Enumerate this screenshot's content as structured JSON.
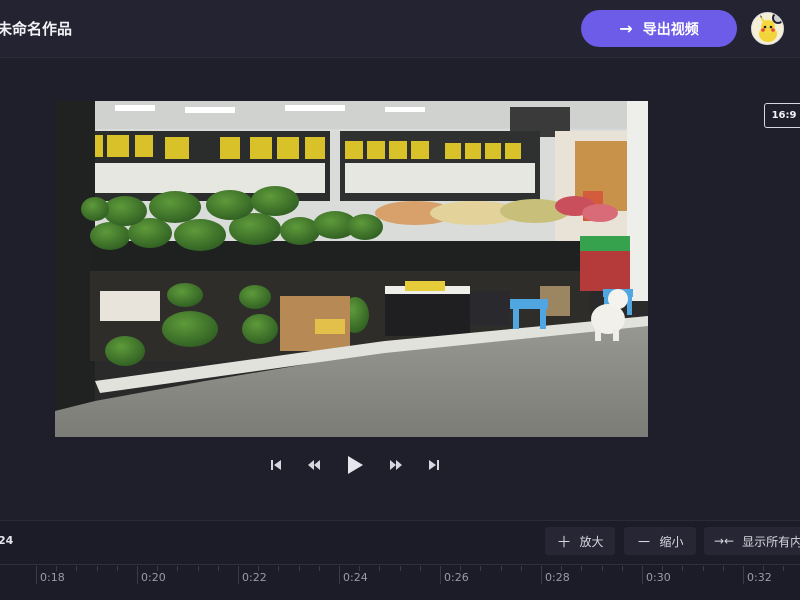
{
  "header": {
    "project_title": "未命名作品",
    "export_label": "导出视频"
  },
  "preview": {
    "aspect_ratio": "16:9"
  },
  "timeline": {
    "current_time": "24",
    "zoom_in_label": "放大",
    "zoom_out_label": "缩小",
    "show_all_label": "显示所有内",
    "ticks": [
      "0:18",
      "0:20",
      "0:22",
      "0:24",
      "0:26",
      "0:28",
      "0:30",
      "0:32"
    ]
  },
  "colors": {
    "accent": "#6c5ce7",
    "background": "#1f1f2c"
  },
  "icons": {
    "export": "arrow-right-icon",
    "zoom_in": "plus-icon",
    "zoom_out": "minus-icon",
    "show_all": "fit-arrows-icon"
  }
}
